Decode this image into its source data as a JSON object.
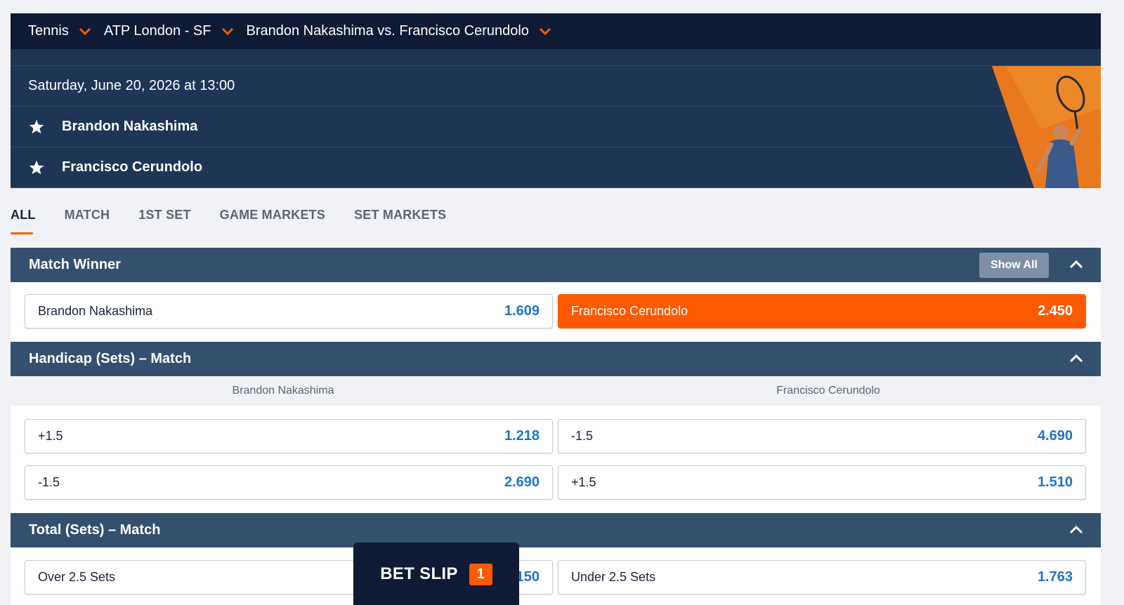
{
  "breadcrumb": [
    {
      "label": "Tennis"
    },
    {
      "label": "ATP London - SF"
    },
    {
      "label": "Brandon Nakashima vs. Francisco Cerundolo"
    }
  ],
  "event": {
    "datetime": "Saturday, June 20, 2026 at 13:00",
    "player1": "Brandon Nakashima",
    "player2": "Francisco Cerundolo"
  },
  "tabs": [
    {
      "label": "ALL",
      "active": true
    },
    {
      "label": "MATCH"
    },
    {
      "label": "1ST SET"
    },
    {
      "label": "GAME MARKETS"
    },
    {
      "label": "SET MARKETS"
    }
  ],
  "markets": {
    "match_winner": {
      "title": "Match Winner",
      "show_all": "Show All",
      "outcomes": [
        {
          "label": "Brandon Nakashima",
          "odds": "1.609"
        },
        {
          "label": "Francisco Cerundolo",
          "odds": "2.450",
          "selected": true
        }
      ]
    },
    "handicap": {
      "title": "Handicap (Sets) – Match",
      "columns": [
        "Brandon Nakashima",
        "Francisco Cerundolo"
      ],
      "outcomes": [
        {
          "label": "+1.5",
          "odds": "1.218"
        },
        {
          "label": "-1.5",
          "odds": "4.690"
        },
        {
          "label": "-1.5",
          "odds": "2.690"
        },
        {
          "label": "+1.5",
          "odds": "1.510"
        }
      ]
    },
    "total_sets": {
      "title": "Total (Sets) – Match",
      "outcomes": [
        {
          "label": "Over 2.5 Sets",
          "odds": "150"
        },
        {
          "label": "Under 2.5 Sets",
          "odds": "1.763"
        }
      ]
    }
  },
  "betslip": {
    "label": "BET SLIP",
    "count": "1"
  },
  "colors": {
    "accent": "#ff5a00",
    "header_dark": "#0f1b34",
    "section": "#34506f",
    "odds_blue": "#1f74c9"
  }
}
